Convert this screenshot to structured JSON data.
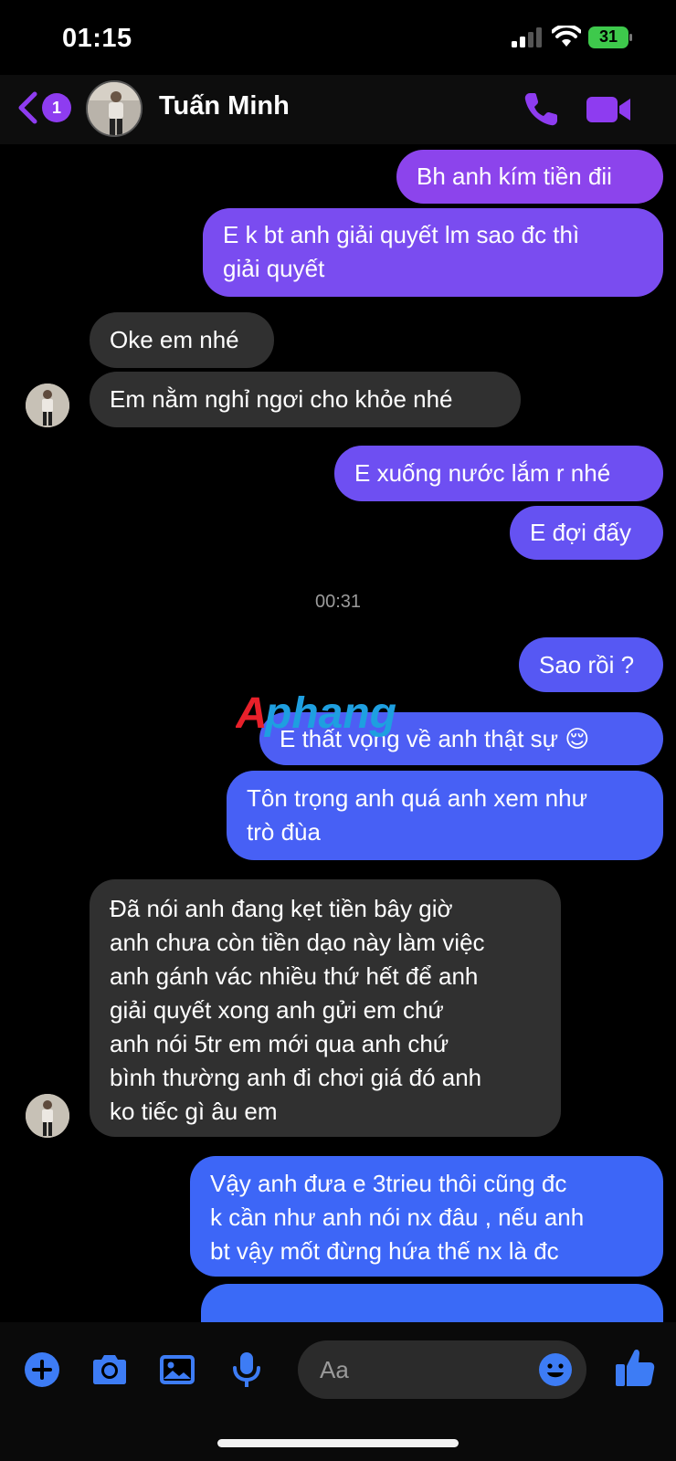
{
  "status_bar": {
    "time": "01:15",
    "battery": "31"
  },
  "header": {
    "unread_count": "1",
    "contact_name": "Tuấn Minh"
  },
  "colors": {
    "accent": "#8e3cf0",
    "incoming": "#303030"
  },
  "messages": [
    {
      "direction": "out",
      "text": "Bh anh kím tiền đii"
    },
    {
      "direction": "out",
      "text": "E k bt anh giải quyết lm sao đc thì\ngiải quyết"
    },
    {
      "direction": "in",
      "text": "Oke em nhé"
    },
    {
      "direction": "in",
      "text": "Em nằm nghỉ ngơi cho khỏe nhé"
    },
    {
      "direction": "out",
      "text": "E xuống nước lắm r nhé"
    },
    {
      "direction": "out",
      "text": "E đợi đấy"
    },
    {
      "direction": "out",
      "text": "Sao rồi ?"
    },
    {
      "direction": "out",
      "text": "E thất vọng về anh thật sự 😌"
    },
    {
      "direction": "out",
      "text": "Tôn trọng anh quá anh xem như\ntrò đùa"
    },
    {
      "direction": "in",
      "text": "Đã nói anh đang kẹt tiền bây giờ\nanh chưa còn tiền dạo này làm việc\nanh gánh vác nhiều thứ hết để anh\ngiải quyết xong anh gửi em chứ\nanh nói 5tr em mới qua anh chứ\nbình thường anh đi chơi giá đó anh\nko tiếc gì âu em"
    },
    {
      "direction": "out",
      "text": "Vậy anh đưa e 3trieu thôi cũng đc\nk cần như anh nói nx đâu , nếu anh\nbt vậy mốt đừng hứa thế nx là đc"
    }
  ],
  "timestamp": "00:31",
  "watermark": "Aphang",
  "composer": {
    "placeholder": "Aa",
    "icons": [
      "plus-icon",
      "camera-icon",
      "image-icon",
      "microphone-icon",
      "emoji-icon",
      "thumbs-up-icon"
    ]
  }
}
